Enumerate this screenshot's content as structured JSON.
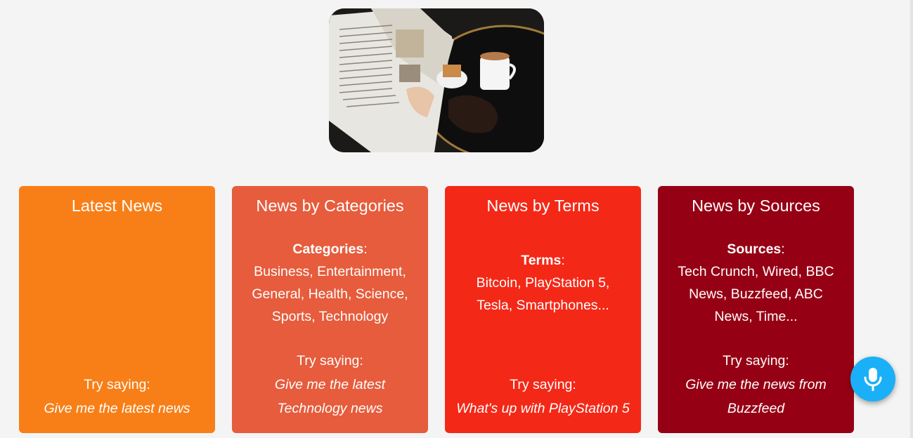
{
  "colors": {
    "page_bg": "#f4f4f4",
    "card_latest": "#f87f17",
    "card_categories": "#e65c3c",
    "card_terms": "#f42817",
    "card_sources": "#960014",
    "mic_button": "#1ab0f7"
  },
  "hero": {
    "icon": "newspaper-coffee-photo"
  },
  "cards": [
    {
      "title": "Latest News",
      "try_label": "Try saying:",
      "example": "Give me the latest news"
    },
    {
      "title": "News by Categories",
      "list_label": "Categories",
      "list_colon": ":",
      "list_text": "Business, Entertainment, General, Health, Science, Sports, Technology",
      "try_label": "Try saying:",
      "example": "Give me the latest Technology news"
    },
    {
      "title": "News by Terms",
      "list_label": "Terms",
      "list_colon": ":",
      "list_text": "Bitcoin, PlayStation 5, Tesla, Smartphones...",
      "try_label": "Try saying:",
      "example": "What's up with PlayStation 5"
    },
    {
      "title": "News by Sources",
      "list_label": "Sources",
      "list_colon": ":",
      "list_text": "Tech Crunch, Wired, BBC News, Buzzfeed, ABC News, Time...",
      "try_label": "Try saying:",
      "example": "Give me the news from Buzzfeed"
    }
  ],
  "mic": {
    "icon": "microphone-icon"
  }
}
